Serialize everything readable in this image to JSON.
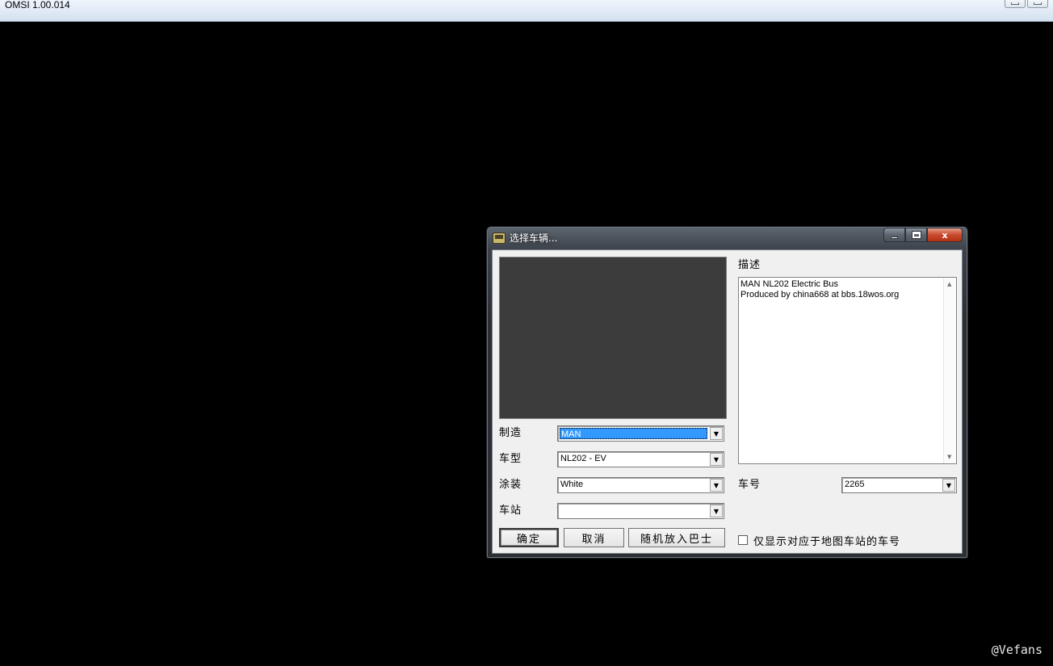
{
  "app": {
    "title": "OMSI 1.00.014"
  },
  "dialog": {
    "title": "选择车辆...",
    "window_controls": {
      "minimize_icon": "minimize-icon",
      "maximize_icon": "maximize-icon",
      "close_label": "x"
    },
    "fields": {
      "manufacturer_label": "制造",
      "manufacturer_value": "MAN",
      "model_label": "车型",
      "model_value": "NL202 - EV",
      "livery_label": "涂装",
      "livery_value": "White",
      "station_label": "车站",
      "station_value": ""
    },
    "description": {
      "label": "描述",
      "lines": [
        "MAN NL202 Electric Bus",
        "Produced by china668 at bbs.18wos.org"
      ]
    },
    "number": {
      "label": "车号",
      "value": "2265"
    },
    "buttons": {
      "ok": "确定",
      "cancel": "取消",
      "random": "随机放入巴士"
    },
    "checkbox": {
      "label": "仅显示对应于地图车站的车号",
      "checked": false
    }
  },
  "watermark": "@Vefans"
}
